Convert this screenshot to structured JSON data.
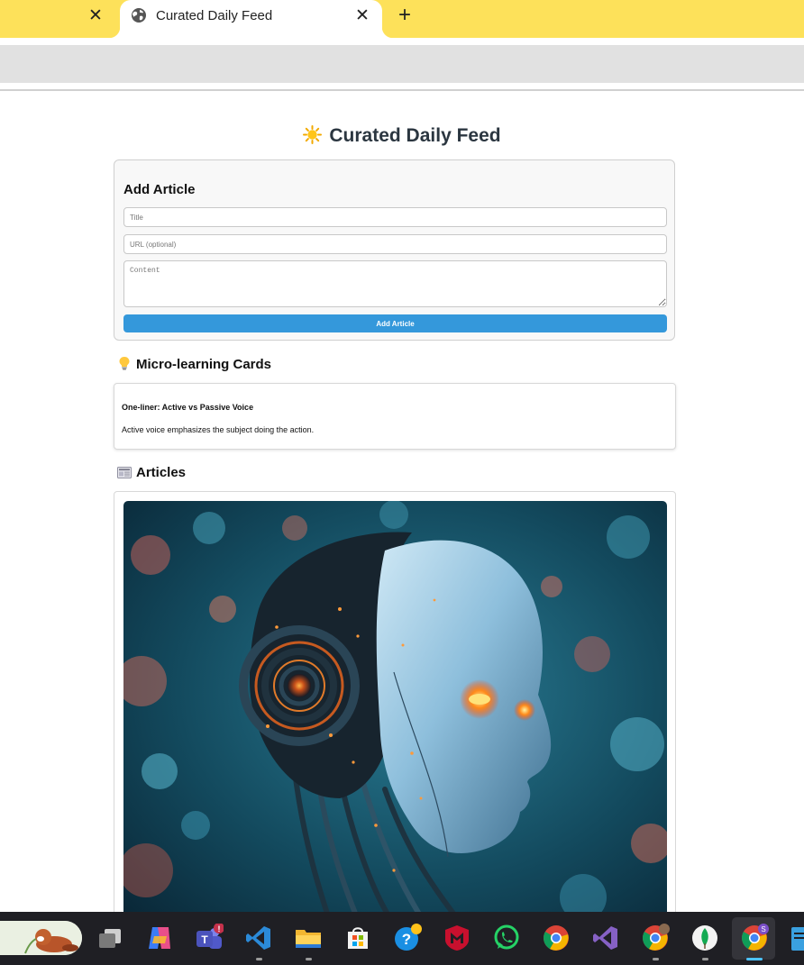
{
  "browser": {
    "active_tab_title": "Curated Daily Feed",
    "close_glyph": "✕",
    "new_tab_glyph": "+"
  },
  "page": {
    "title": "Curated Daily Feed",
    "title_emoji": "sun-emoji"
  },
  "add_article": {
    "heading": "Add Article",
    "title_placeholder": "Title",
    "url_placeholder": "URL (optional)",
    "content_placeholder": "Content",
    "button_label": "Add Article"
  },
  "micro_learning": {
    "heading": "Micro-learning Cards",
    "heading_emoji": "lightbulb-emoji",
    "cards": [
      {
        "title": "One-liner: Active vs Passive Voice",
        "text": "Active voice emphasizes the subject doing the action."
      }
    ]
  },
  "articles": {
    "heading": "Articles",
    "heading_emoji": "newspaper-emoji"
  },
  "colors": {
    "tabstrip": "#fde15a",
    "button": "#3498db",
    "title_text": "#2b3640",
    "taskbar": "#1f1f24"
  },
  "taskbar": {
    "apps": [
      "red-panda-search",
      "task-view",
      "copilot",
      "teams",
      "vscode",
      "file-explorer",
      "microsoft-store",
      "get-help",
      "mcafee",
      "whatsapp",
      "chrome",
      "visual-studio",
      "chrome-profile",
      "mongodb-compass",
      "chrome-active",
      "notepad"
    ]
  }
}
